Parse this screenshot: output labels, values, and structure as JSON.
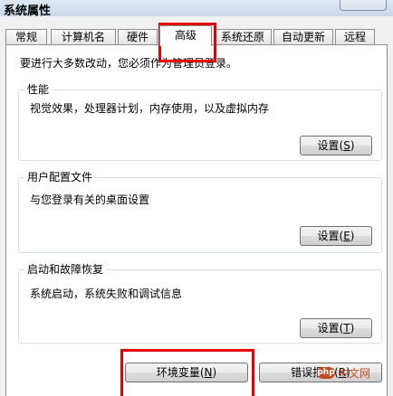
{
  "window": {
    "title": "系统属性"
  },
  "tabs": [
    {
      "label": "常规",
      "active": false
    },
    {
      "label": "计算机名",
      "active": false
    },
    {
      "label": "硬件",
      "active": false
    },
    {
      "label": "高级",
      "active": true
    },
    {
      "label": "系统还原",
      "active": false
    },
    {
      "label": "自动更新",
      "active": false
    },
    {
      "label": "远程",
      "active": false
    }
  ],
  "admin_note": "要进行大多数改动，您必须作为管理员登录。",
  "performance": {
    "title": "性能",
    "description": "视觉效果，处理器计划，内存使用，以及虚拟内存",
    "button": {
      "label": "设置",
      "hotkey": "S"
    }
  },
  "user_profiles": {
    "title": "用户配置文件",
    "description": "与您登录有关的桌面设置",
    "button": {
      "label": "设置",
      "hotkey": "E"
    }
  },
  "startup_recovery": {
    "title": "启动和故障恢复",
    "description": "系统启动，系统失败和调试信息",
    "button": {
      "label": "设置",
      "hotkey": "T"
    }
  },
  "footer_buttons": {
    "environment_variables": {
      "label": "环境变量",
      "hotkey": "N"
    },
    "error_reporting": {
      "label": "错误报告",
      "hotkey": "R"
    }
  },
  "watermark": {
    "logo": "php",
    "text": "中文网"
  },
  "colors": {
    "highlight": "#e60000",
    "watermark": "#c44b1f"
  }
}
